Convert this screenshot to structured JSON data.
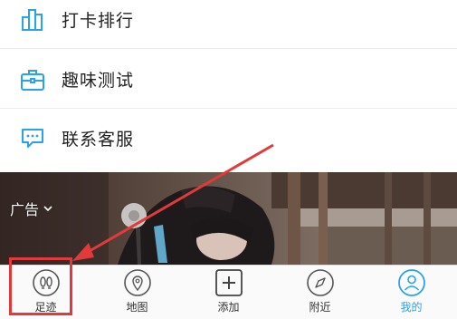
{
  "menu": {
    "items": [
      {
        "label": "打卡排行",
        "icon": "ranking-icon"
      },
      {
        "label": "趣味测试",
        "icon": "briefcase-icon"
      },
      {
        "label": "联系客服",
        "icon": "chat-icon"
      }
    ]
  },
  "ad": {
    "label": "广告"
  },
  "tabbar": {
    "tabs": [
      {
        "label": "足迹",
        "icon": "footprint-icon"
      },
      {
        "label": "地图",
        "icon": "map-pin-icon"
      },
      {
        "label": "添加",
        "icon": "plus-icon"
      },
      {
        "label": "附近",
        "icon": "compass-icon"
      },
      {
        "label": "我的",
        "icon": "user-icon",
        "active": true
      }
    ]
  },
  "colors": {
    "accent": "#29a3e8",
    "annotation": "#e23a3a"
  }
}
